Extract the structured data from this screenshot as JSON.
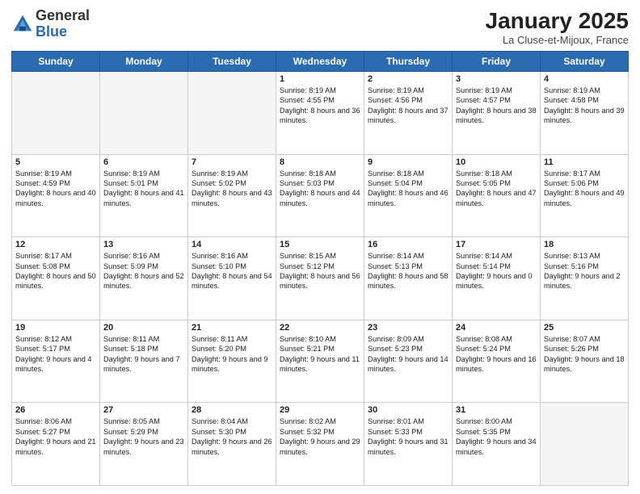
{
  "header": {
    "logo_general": "General",
    "logo_blue": "Blue",
    "month_title": "January 2025",
    "location": "La Cluse-et-Mijoux, France"
  },
  "weekdays": [
    "Sunday",
    "Monday",
    "Tuesday",
    "Wednesday",
    "Thursday",
    "Friday",
    "Saturday"
  ],
  "weeks": [
    [
      {
        "day": "",
        "text": "",
        "empty": true
      },
      {
        "day": "",
        "text": "",
        "empty": true
      },
      {
        "day": "",
        "text": "",
        "empty": true
      },
      {
        "day": "1",
        "text": "Sunrise: 8:19 AM\nSunset: 4:55 PM\nDaylight: 8 hours\nand 36 minutes.",
        "empty": false
      },
      {
        "day": "2",
        "text": "Sunrise: 8:19 AM\nSunset: 4:56 PM\nDaylight: 8 hours\nand 37 minutes.",
        "empty": false
      },
      {
        "day": "3",
        "text": "Sunrise: 8:19 AM\nSunset: 4:57 PM\nDaylight: 8 hours\nand 38 minutes.",
        "empty": false
      },
      {
        "day": "4",
        "text": "Sunrise: 8:19 AM\nSunset: 4:58 PM\nDaylight: 8 hours\nand 39 minutes.",
        "empty": false
      }
    ],
    [
      {
        "day": "5",
        "text": "Sunrise: 8:19 AM\nSunset: 4:59 PM\nDaylight: 8 hours\nand 40 minutes.",
        "empty": false
      },
      {
        "day": "6",
        "text": "Sunrise: 8:19 AM\nSunset: 5:01 PM\nDaylight: 8 hours\nand 41 minutes.",
        "empty": false
      },
      {
        "day": "7",
        "text": "Sunrise: 8:19 AM\nSunset: 5:02 PM\nDaylight: 8 hours\nand 43 minutes.",
        "empty": false
      },
      {
        "day": "8",
        "text": "Sunrise: 8:18 AM\nSunset: 5:03 PM\nDaylight: 8 hours\nand 44 minutes.",
        "empty": false
      },
      {
        "day": "9",
        "text": "Sunrise: 8:18 AM\nSunset: 5:04 PM\nDaylight: 8 hours\nand 46 minutes.",
        "empty": false
      },
      {
        "day": "10",
        "text": "Sunrise: 8:18 AM\nSunset: 5:05 PM\nDaylight: 8 hours\nand 47 minutes.",
        "empty": false
      },
      {
        "day": "11",
        "text": "Sunrise: 8:17 AM\nSunset: 5:06 PM\nDaylight: 8 hours\nand 49 minutes.",
        "empty": false
      }
    ],
    [
      {
        "day": "12",
        "text": "Sunrise: 8:17 AM\nSunset: 5:08 PM\nDaylight: 8 hours\nand 50 minutes.",
        "empty": false
      },
      {
        "day": "13",
        "text": "Sunrise: 8:16 AM\nSunset: 5:09 PM\nDaylight: 8 hours\nand 52 minutes.",
        "empty": false
      },
      {
        "day": "14",
        "text": "Sunrise: 8:16 AM\nSunset: 5:10 PM\nDaylight: 8 hours\nand 54 minutes.",
        "empty": false
      },
      {
        "day": "15",
        "text": "Sunrise: 8:15 AM\nSunset: 5:12 PM\nDaylight: 8 hours\nand 56 minutes.",
        "empty": false
      },
      {
        "day": "16",
        "text": "Sunrise: 8:14 AM\nSunset: 5:13 PM\nDaylight: 8 hours\nand 58 minutes.",
        "empty": false
      },
      {
        "day": "17",
        "text": "Sunrise: 8:14 AM\nSunset: 5:14 PM\nDaylight: 9 hours\nand 0 minutes.",
        "empty": false
      },
      {
        "day": "18",
        "text": "Sunrise: 8:13 AM\nSunset: 5:16 PM\nDaylight: 9 hours\nand 2 minutes.",
        "empty": false
      }
    ],
    [
      {
        "day": "19",
        "text": "Sunrise: 8:12 AM\nSunset: 5:17 PM\nDaylight: 9 hours\nand 4 minutes.",
        "empty": false
      },
      {
        "day": "20",
        "text": "Sunrise: 8:11 AM\nSunset: 5:18 PM\nDaylight: 9 hours\nand 7 minutes.",
        "empty": false
      },
      {
        "day": "21",
        "text": "Sunrise: 8:11 AM\nSunset: 5:20 PM\nDaylight: 9 hours\nand 9 minutes.",
        "empty": false
      },
      {
        "day": "22",
        "text": "Sunrise: 8:10 AM\nSunset: 5:21 PM\nDaylight: 9 hours\nand 11 minutes.",
        "empty": false
      },
      {
        "day": "23",
        "text": "Sunrise: 8:09 AM\nSunset: 5:23 PM\nDaylight: 9 hours\nand 14 minutes.",
        "empty": false
      },
      {
        "day": "24",
        "text": "Sunrise: 8:08 AM\nSunset: 5:24 PM\nDaylight: 9 hours\nand 16 minutes.",
        "empty": false
      },
      {
        "day": "25",
        "text": "Sunrise: 8:07 AM\nSunset: 5:26 PM\nDaylight: 9 hours\nand 18 minutes.",
        "empty": false
      }
    ],
    [
      {
        "day": "26",
        "text": "Sunrise: 8:06 AM\nSunset: 5:27 PM\nDaylight: 9 hours\nand 21 minutes.",
        "empty": false
      },
      {
        "day": "27",
        "text": "Sunrise: 8:05 AM\nSunset: 5:29 PM\nDaylight: 9 hours\nand 23 minutes.",
        "empty": false
      },
      {
        "day": "28",
        "text": "Sunrise: 8:04 AM\nSunset: 5:30 PM\nDaylight: 9 hours\nand 26 minutes.",
        "empty": false
      },
      {
        "day": "29",
        "text": "Sunrise: 8:02 AM\nSunset: 5:32 PM\nDaylight: 9 hours\nand 29 minutes.",
        "empty": false
      },
      {
        "day": "30",
        "text": "Sunrise: 8:01 AM\nSunset: 5:33 PM\nDaylight: 9 hours\nand 31 minutes.",
        "empty": false
      },
      {
        "day": "31",
        "text": "Sunrise: 8:00 AM\nSunset: 5:35 PM\nDaylight: 9 hours\nand 34 minutes.",
        "empty": false
      },
      {
        "day": "",
        "text": "",
        "empty": true
      }
    ]
  ]
}
